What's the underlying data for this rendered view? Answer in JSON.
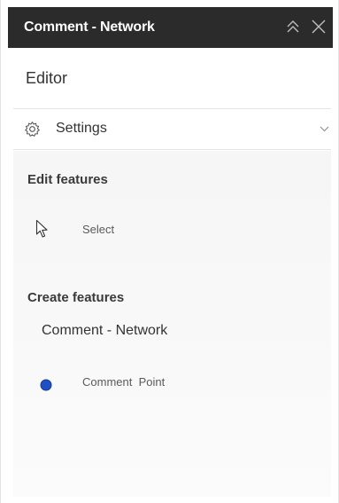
{
  "header": {
    "title": "Comment - Network",
    "collapse_icon": "double-chevron-up-icon",
    "close_icon": "close-icon"
  },
  "editor": {
    "heading": "Editor"
  },
  "settings": {
    "label": "Settings",
    "icon": "gear-icon",
    "chevron_icon": "chevron-down-icon"
  },
  "edit_features": {
    "title": "Edit features",
    "select_label": "Select",
    "select_icon": "cursor-arrow-icon"
  },
  "create_features": {
    "title": "Create features",
    "layer_name": "Comment - Network",
    "templates": [
      {
        "label": "Comment  Point",
        "icon": "point-symbol-icon",
        "color": "#1f4fc4"
      }
    ]
  },
  "colors": {
    "header_bg": "#2b2b2b",
    "header_text": "#ffffff",
    "point_symbol": "#1f4fc4"
  }
}
